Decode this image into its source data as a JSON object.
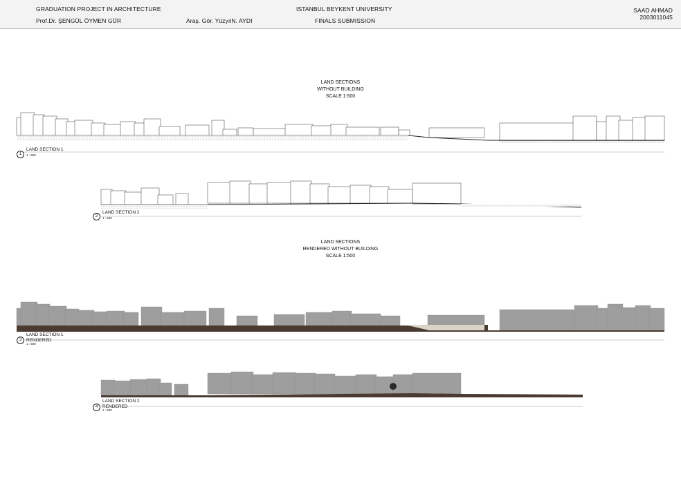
{
  "header": {
    "project": "GRADUATION PROJECT IN ARCHITECTURE",
    "supervisor": "Prof.Dr. ŞENGÜL ÖYMEN GÜR",
    "assistant": "Araş. Gör. YüzyılN. AYDI",
    "university": "ISTANBUL BEYKENT UNIVERSITY",
    "submission": "FINALS SUBMISSION",
    "student_name": "SAAD AHMAD",
    "student_id": "2003011045"
  },
  "block1": {
    "line1": "LAND SECTIONS",
    "line2": "WITHOUT BUILDING",
    "line3": "SCALE 1:500"
  },
  "block2": {
    "line1": "LAND SECTIONS",
    "line2": "RENDERED WITHOUT BUILDING",
    "line3": "SCALE 1:500"
  },
  "sections": [
    {
      "number": "1",
      "title": "LAND SECTION 1",
      "subtitle": "",
      "scale": "1 : 500"
    },
    {
      "number": "2",
      "title": "LAND SECTION 2",
      "subtitle": "",
      "scale": "1 : 500"
    },
    {
      "number": "3",
      "title": "LAND SECTION 1",
      "subtitle": "RENDERED",
      "scale": "1 : 500"
    },
    {
      "number": "4",
      "title": "LAND SECTION 2",
      "subtitle": "RENDERED",
      "scale": "1 : 500"
    }
  ],
  "colors": {
    "building_fill": "#9e9e9e",
    "ground_fill": "#4a3a30",
    "line": "#222222"
  }
}
